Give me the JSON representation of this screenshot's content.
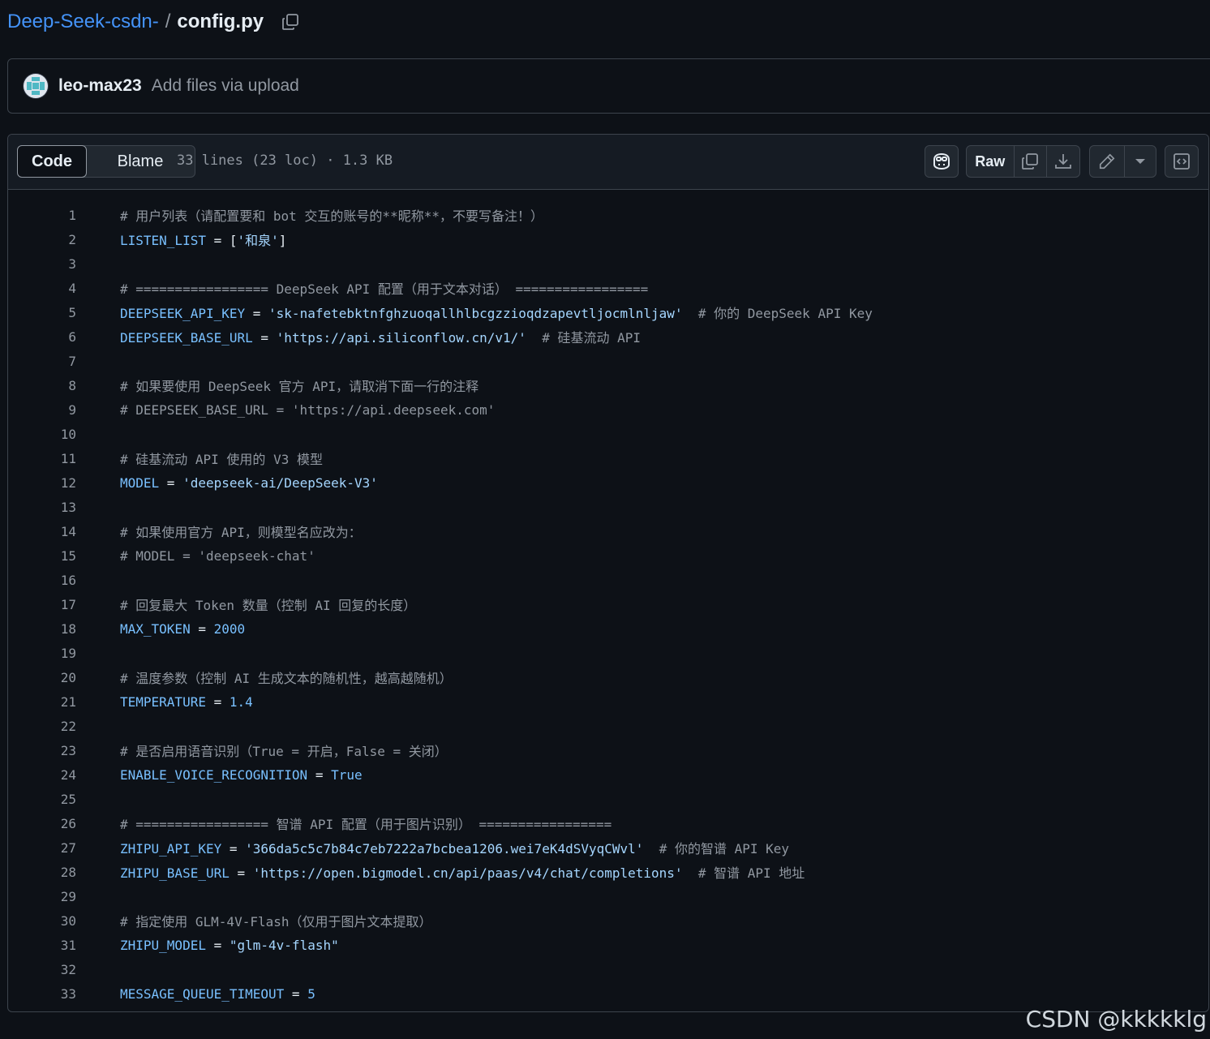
{
  "breadcrumb": {
    "repo": "Deep-Seek-csdn-",
    "separator": "/",
    "file": "config.py"
  },
  "commit": {
    "author": "leo-max23",
    "message": "Add files via upload"
  },
  "file_header": {
    "tabs": [
      {
        "label": "Code",
        "active": true
      },
      {
        "label": "Blame",
        "active": false
      }
    ],
    "info": "33 lines (23 loc) · 1.3 KB",
    "raw_label": "Raw"
  },
  "code_lines": [
    {
      "n": "1",
      "tokens": [
        {
          "t": "comment",
          "v": "# 用户列表（请配置要和 bot 交互的账号的**昵称**，不要写备注！）"
        }
      ]
    },
    {
      "n": "2",
      "tokens": [
        {
          "t": "var",
          "v": "LISTEN_LIST"
        },
        {
          "t": "op",
          "v": " = "
        },
        {
          "t": "op",
          "v": "["
        },
        {
          "t": "str",
          "v": "'和泉'"
        },
        {
          "t": "op",
          "v": "]"
        }
      ]
    },
    {
      "n": "3",
      "tokens": []
    },
    {
      "n": "4",
      "tokens": [
        {
          "t": "comment",
          "v": "# ================= DeepSeek API 配置（用于文本对话） ================="
        }
      ]
    },
    {
      "n": "5",
      "tokens": [
        {
          "t": "var",
          "v": "DEEPSEEK_API_KEY"
        },
        {
          "t": "op",
          "v": " = "
        },
        {
          "t": "str",
          "v": "'sk-nafetebktnfghzuoqallhlbcgzzioqdzapevtljocmlnljaw'"
        },
        {
          "t": "comment",
          "v": "  # 你的 DeepSeek API Key"
        }
      ]
    },
    {
      "n": "6",
      "tokens": [
        {
          "t": "var",
          "v": "DEEPSEEK_BASE_URL"
        },
        {
          "t": "op",
          "v": " = "
        },
        {
          "t": "str",
          "v": "'https://api.siliconflow.cn/v1/'"
        },
        {
          "t": "comment",
          "v": "  # 硅基流动 API"
        }
      ]
    },
    {
      "n": "7",
      "tokens": []
    },
    {
      "n": "8",
      "tokens": [
        {
          "t": "comment",
          "v": "# 如果要使用 DeepSeek 官方 API，请取消下面一行的注释"
        }
      ]
    },
    {
      "n": "9",
      "tokens": [
        {
          "t": "comment",
          "v": "# DEEPSEEK_BASE_URL = 'https://api.deepseek.com'"
        }
      ]
    },
    {
      "n": "10",
      "tokens": []
    },
    {
      "n": "11",
      "tokens": [
        {
          "t": "comment",
          "v": "# 硅基流动 API 使用的 V3 模型"
        }
      ]
    },
    {
      "n": "12",
      "tokens": [
        {
          "t": "var",
          "v": "MODEL"
        },
        {
          "t": "op",
          "v": " = "
        },
        {
          "t": "str",
          "v": "'deepseek-ai/DeepSeek-V3'"
        }
      ]
    },
    {
      "n": "13",
      "tokens": []
    },
    {
      "n": "14",
      "tokens": [
        {
          "t": "comment",
          "v": "# 如果使用官方 API，则模型名应改为："
        }
      ]
    },
    {
      "n": "15",
      "tokens": [
        {
          "t": "comment",
          "v": "# MODEL = 'deepseek-chat'"
        }
      ]
    },
    {
      "n": "16",
      "tokens": []
    },
    {
      "n": "17",
      "tokens": [
        {
          "t": "comment",
          "v": "# 回复最大 Token 数量（控制 AI 回复的长度）"
        }
      ]
    },
    {
      "n": "18",
      "tokens": [
        {
          "t": "var",
          "v": "MAX_TOKEN"
        },
        {
          "t": "op",
          "v": " = "
        },
        {
          "t": "num",
          "v": "2000"
        }
      ]
    },
    {
      "n": "19",
      "tokens": []
    },
    {
      "n": "20",
      "tokens": [
        {
          "t": "comment",
          "v": "# 温度参数（控制 AI 生成文本的随机性，越高越随机）"
        }
      ]
    },
    {
      "n": "21",
      "tokens": [
        {
          "t": "var",
          "v": "TEMPERATURE"
        },
        {
          "t": "op",
          "v": " = "
        },
        {
          "t": "num",
          "v": "1.4"
        }
      ]
    },
    {
      "n": "22",
      "tokens": []
    },
    {
      "n": "23",
      "tokens": [
        {
          "t": "comment",
          "v": "# 是否启用语音识别（True = 开启，False = 关闭）"
        }
      ]
    },
    {
      "n": "24",
      "tokens": [
        {
          "t": "var",
          "v": "ENABLE_VOICE_RECOGNITION"
        },
        {
          "t": "op",
          "v": " = "
        },
        {
          "t": "num",
          "v": "True"
        }
      ]
    },
    {
      "n": "25",
      "tokens": []
    },
    {
      "n": "26",
      "tokens": [
        {
          "t": "comment",
          "v": "# ================= 智谱 API 配置（用于图片识别） ================="
        }
      ]
    },
    {
      "n": "27",
      "tokens": [
        {
          "t": "var",
          "v": "ZHIPU_API_KEY"
        },
        {
          "t": "op",
          "v": " = "
        },
        {
          "t": "str",
          "v": "'366da5c5c7b84c7eb7222a7bcbea1206.wei7eK4dSVyqCWvl'"
        },
        {
          "t": "comment",
          "v": "  # 你的智谱 API Key"
        }
      ]
    },
    {
      "n": "28",
      "tokens": [
        {
          "t": "var",
          "v": "ZHIPU_BASE_URL"
        },
        {
          "t": "op",
          "v": " = "
        },
        {
          "t": "str",
          "v": "'https://open.bigmodel.cn/api/paas/v4/chat/completions'"
        },
        {
          "t": "comment",
          "v": "  # 智谱 API 地址"
        }
      ]
    },
    {
      "n": "29",
      "tokens": []
    },
    {
      "n": "30",
      "tokens": [
        {
          "t": "comment",
          "v": "# 指定使用 GLM-4V-Flash（仅用于图片文本提取）"
        }
      ]
    },
    {
      "n": "31",
      "tokens": [
        {
          "t": "var",
          "v": "ZHIPU_MODEL"
        },
        {
          "t": "op",
          "v": " = "
        },
        {
          "t": "str",
          "v": "\"glm-4v-flash\""
        }
      ]
    },
    {
      "n": "32",
      "tokens": []
    },
    {
      "n": "33",
      "tokens": [
        {
          "t": "var",
          "v": "MESSAGE_QUEUE_TIMEOUT"
        },
        {
          "t": "op",
          "v": " = "
        },
        {
          "t": "num",
          "v": "5"
        }
      ]
    }
  ],
  "watermark": "CSDN @kkkkklg",
  "colors": {
    "background": "#0d1117",
    "link": "#4493f8",
    "comment": "#9198a1",
    "variable": "#79c0ff",
    "string": "#a5d6ff",
    "border": "#3d444d"
  },
  "icons": {
    "copy_path": "copy-icon",
    "avatar": "identicon-avatar",
    "copilot": "copilot-icon",
    "copy_raw": "copy-icon",
    "download": "download-icon",
    "edit": "pencil-icon",
    "more": "triangle-down-icon",
    "symbols": "code-square-icon"
  }
}
